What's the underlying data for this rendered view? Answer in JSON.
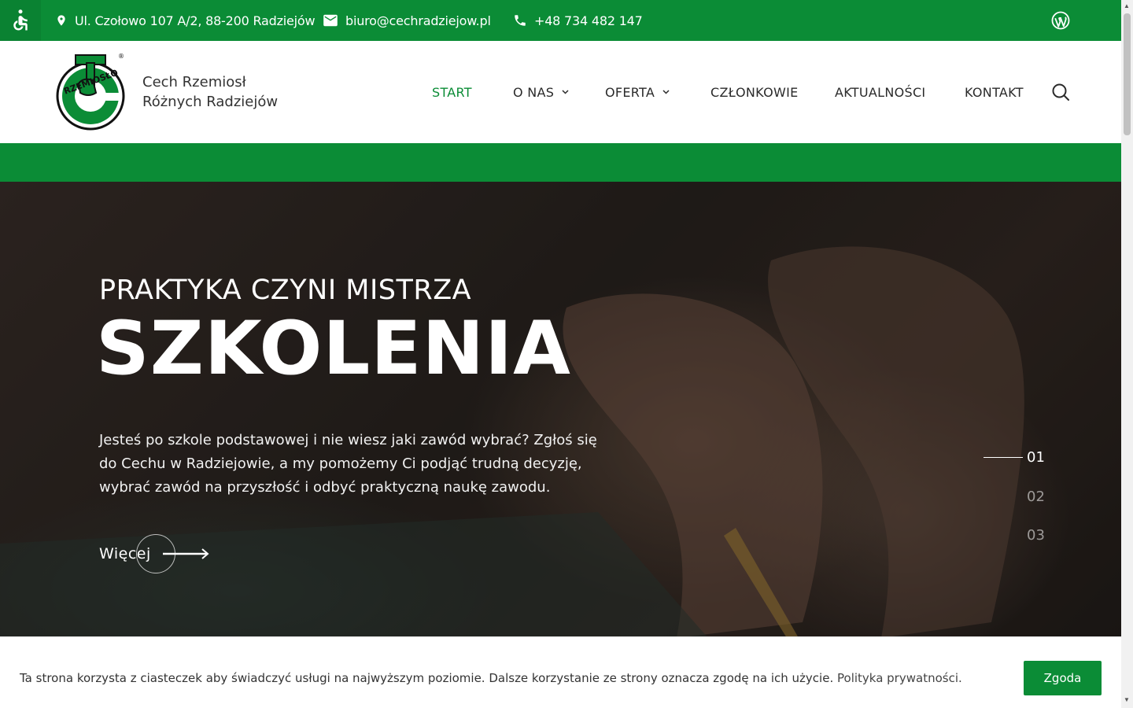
{
  "topbar": {
    "address": "Ul. Czołowo 107 A/2, 88-200 Radziejów",
    "email": "biuro@cechradziejow.pl",
    "phone": "+48 734 482 147"
  },
  "header": {
    "brand_line1": "Cech Rzemiosł",
    "brand_line2": "Różnych Radziejów",
    "logo_text": "RZEMIOSŁO",
    "nav": [
      {
        "label": "START"
      },
      {
        "label": "O NAS"
      },
      {
        "label": "OFERTA"
      },
      {
        "label": "CZŁONKOWIE"
      },
      {
        "label": "AKTUALNOŚCI"
      },
      {
        "label": "KONTAKT"
      }
    ]
  },
  "hero": {
    "subtitle": "PRAKTYKA CZYNI MISTRZA",
    "title": "SZKOLENIA",
    "text": "Jesteś po szkole podstawowej i nie wiesz jaki zawód wybrać? Zgłoś się do Cechu w Radziejowie, a my pomożemy Ci podjąć trudną decyzję, wybrać zawód na przyszłość i odbyć praktyczną naukę zawodu.",
    "more_label": "Więcej",
    "slides": [
      "01",
      "02",
      "03"
    ]
  },
  "cookie": {
    "text": "Ta strona korzysta z ciasteczek aby świadczyć usługi na najwyższym poziomie. Dalsze korzystanie ze strony oznacza zgodę na ich użycie.",
    "link": "Polityka prywatności.",
    "accept": "Zgoda"
  },
  "colors": {
    "brand_green": "#0b8c36",
    "white": "#ffffff"
  }
}
